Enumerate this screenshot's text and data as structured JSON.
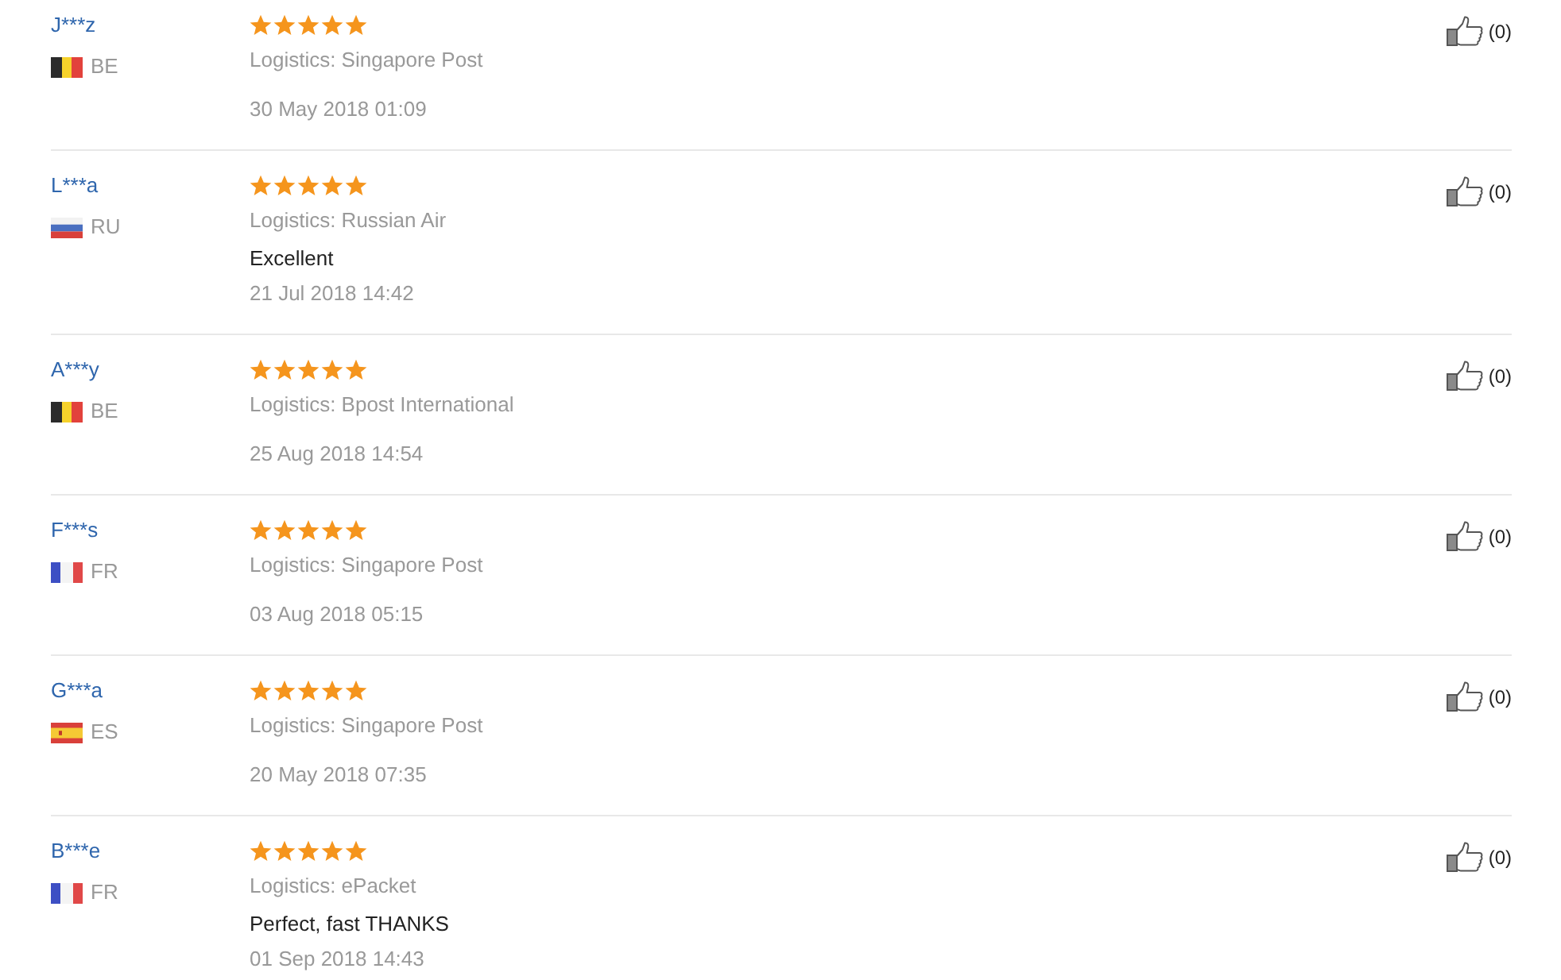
{
  "reviews": [
    {
      "name": "J***z",
      "flag": {
        "kind": "belgium"
      },
      "country": "BE",
      "stars": 5,
      "logistics": "Logistics: Singapore Post",
      "date": "30 May 2018 01:09",
      "likes": "(0)"
    },
    {
      "name": "L***a",
      "flag": {
        "kind": "russia"
      },
      "country": "RU",
      "stars": 5,
      "logistics": "Logistics: Russian Air",
      "comment": "Excellent",
      "date": "21 Jul 2018 14:42",
      "likes": "(0)"
    },
    {
      "name": "A***y",
      "flag": {
        "kind": "belgium"
      },
      "country": "BE",
      "stars": 5,
      "logistics": "Logistics: Bpost International",
      "date": "25 Aug 2018 14:54",
      "likes": "(0)"
    },
    {
      "name": "F***s",
      "flag": {
        "kind": "france"
      },
      "country": "FR",
      "stars": 5,
      "logistics": "Logistics: Singapore Post",
      "date": "03 Aug 2018 05:15",
      "likes": "(0)"
    },
    {
      "name": "G***a",
      "flag": {
        "kind": "spain"
      },
      "country": "ES",
      "stars": 5,
      "logistics": "Logistics: Singapore Post",
      "date": "20 May 2018 07:35",
      "likes": "(0)"
    },
    {
      "name": "B***e",
      "flag": {
        "kind": "france"
      },
      "country": "FR",
      "stars": 5,
      "logistics": "Logistics: ePacket",
      "comment": "Perfect, fast THANKS",
      "date": "01 Sep 2018 14:43",
      "likes": "(0)"
    }
  ]
}
